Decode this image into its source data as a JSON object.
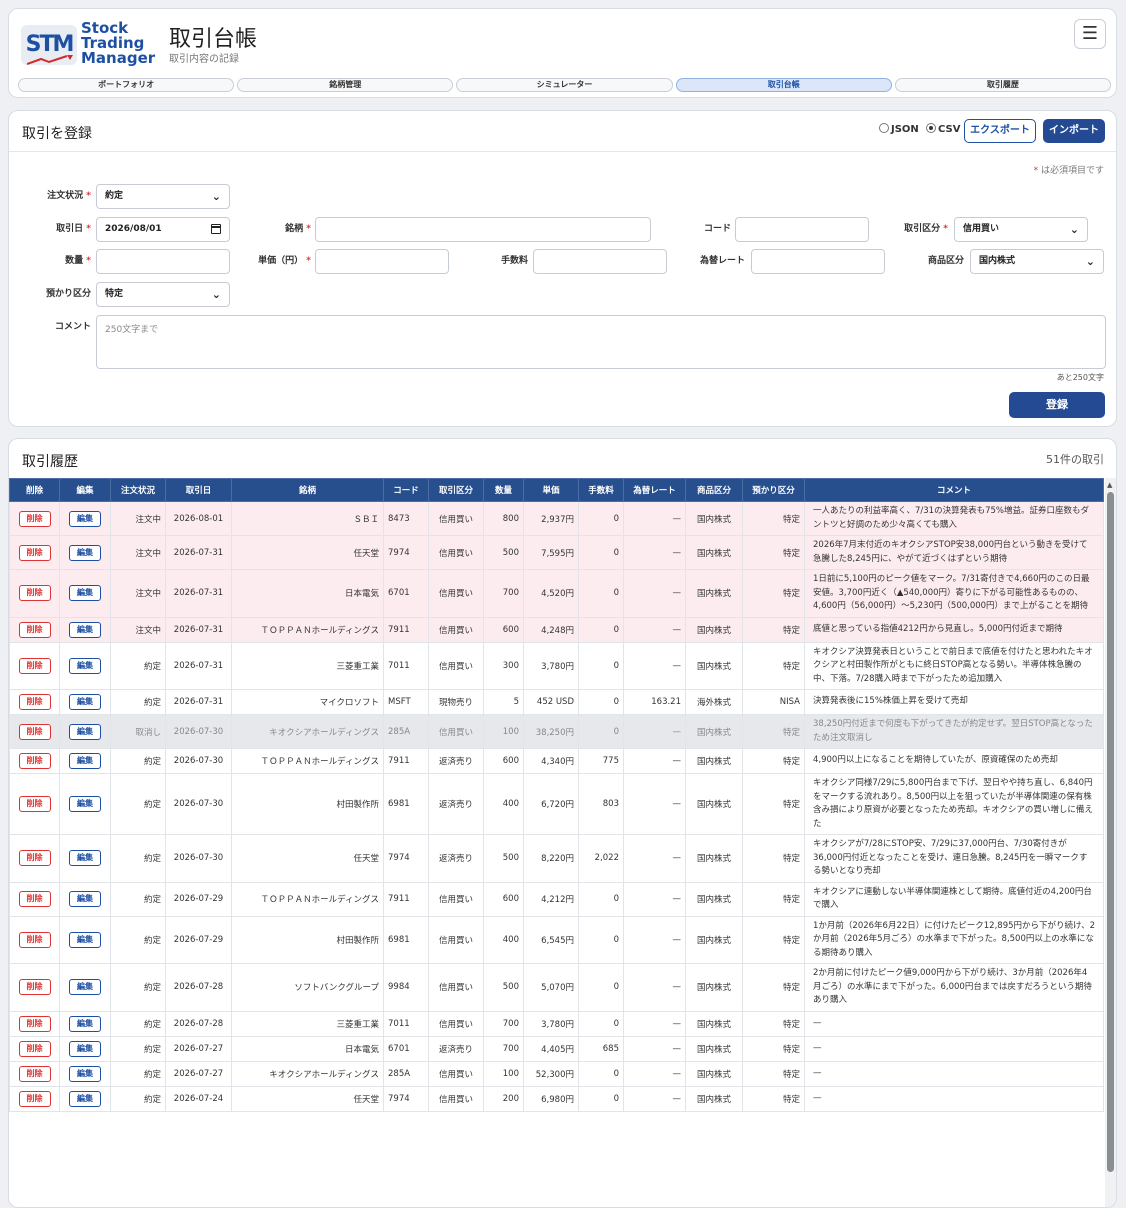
{
  "app": {
    "logo_short": "STM",
    "logo_line1": "Stock",
    "logo_line2": "Trading",
    "logo_line3": "Manager",
    "title": "取引台帳",
    "subtitle": "取引内容の記録"
  },
  "tabs": [
    {
      "label": "ポートフォリオ"
    },
    {
      "label": "銘柄管理"
    },
    {
      "label": "シミュレーター"
    },
    {
      "label": "取引台帳",
      "active": true
    },
    {
      "label": "取引履歴"
    }
  ],
  "form": {
    "title": "取引を登録",
    "json_label": "JSON",
    "csv_label": "CSV",
    "export_label": "エクスポート",
    "import_label": "インポート",
    "required_note_mark": "*",
    "required_note": " は必須項目です",
    "labels": {
      "order_status": "注文状況",
      "trade_date": "取引日",
      "name": "銘柄",
      "code": "コード",
      "trade_type": "取引区分",
      "quantity": "数量",
      "price": "単価（円）",
      "fee": "手数料",
      "fx_rate": "為替レート",
      "product": "商品区分",
      "deposit": "預かり区分",
      "comment": "コメント"
    },
    "values": {
      "order_status": "約定",
      "trade_date": "2026/08/01",
      "trade_type": "信用買い",
      "product": "国内株式",
      "deposit": "特定"
    },
    "comment_placeholder": "250文字まで",
    "counter": "あと250文字",
    "submit_label": "登録"
  },
  "history": {
    "title": "取引履歴",
    "count": "51件の取引",
    "delete_label": "削除",
    "edit_label": "編集",
    "columns": [
      "削除",
      "編集",
      "注文状況",
      "取引日",
      "銘柄",
      "コード",
      "取引区分",
      "数量",
      "単価",
      "手数料",
      "為替レート",
      "商品区分",
      "預かり区分",
      "コメント"
    ],
    "rows": [
      {
        "status": "注文中",
        "date": "2026-08-01",
        "name": "ＳＢＩ",
        "code": "8473",
        "type": "信用買い",
        "qty": "800",
        "price": "2,937円",
        "fee": "0",
        "fx": "—",
        "product": "国内株式",
        "deposit": "特定",
        "comment": "一人あたりの利益率高く、7/31の決算発表も75%増益。証券口座数もダントツと好調のため少々高くても購入",
        "state": "pending"
      },
      {
        "status": "注文中",
        "date": "2026-07-31",
        "name": "任天堂",
        "code": "7974",
        "type": "信用買い",
        "qty": "500",
        "price": "7,595円",
        "fee": "0",
        "fx": "—",
        "product": "国内株式",
        "deposit": "特定",
        "comment": "2026年7月末付近のキオクシアSTOP安38,000円台という動きを受けて急騰した8,245円に、やがて近づくはずという期待",
        "state": "pending"
      },
      {
        "status": "注文中",
        "date": "2026-07-31",
        "name": "日本電気",
        "code": "6701",
        "type": "信用買い",
        "qty": "700",
        "price": "4,520円",
        "fee": "0",
        "fx": "—",
        "product": "国内株式",
        "deposit": "特定",
        "comment": "1日前に5,100円のピーク値をマーク。7/31寄付きで4,660円のこの日最安値。3,700円近く（▲540,000円）寄りに下がる可能性あるものの、4,600円（56,000円）～5,230円（500,000円）まで上がることを期待",
        "state": "pending"
      },
      {
        "status": "注文中",
        "date": "2026-07-31",
        "name": "ＴＯＰＰＡＮホールディングス",
        "code": "7911",
        "type": "信用買い",
        "qty": "600",
        "price": "4,248円",
        "fee": "0",
        "fx": "—",
        "product": "国内株式",
        "deposit": "特定",
        "comment": "底値と思っている指値4212円から見直し。5,000円付近まで期待",
        "state": "pending"
      },
      {
        "status": "約定",
        "date": "2026-07-31",
        "name": "三菱重工業",
        "code": "7011",
        "type": "信用買い",
        "qty": "300",
        "price": "3,780円",
        "fee": "0",
        "fx": "—",
        "product": "国内株式",
        "deposit": "特定",
        "comment": "キオクシア決算発表日ということで前日まで底値を付けたと思われたキオクシアと村田製作所がともに終日STOP高となる勢い。半導体株急騰の中、下落。7/28購入時まで下がったため追加購入",
        "state": ""
      },
      {
        "status": "約定",
        "date": "2026-07-31",
        "name": "マイクロソフト",
        "code": "MSFT",
        "type": "現物売り",
        "qty": "5",
        "price": "452 USD",
        "fee": "0",
        "fx": "163.21",
        "product": "海外株式",
        "deposit": "NISA",
        "comment": "決算発表後に15%株価上昇を受けて売却",
        "state": ""
      },
      {
        "status": "取消し",
        "date": "2026-07-30",
        "name": "キオクシアホールディングス",
        "code": "285A",
        "type": "信用買い",
        "qty": "100",
        "price": "38,250円",
        "fee": "0",
        "fx": "—",
        "product": "国内株式",
        "deposit": "特定",
        "comment": "38,250円付近まで何度も下がってきたが約定せず。翌日STOP高となったため注文取消し",
        "state": "cancel"
      },
      {
        "status": "約定",
        "date": "2026-07-30",
        "name": "ＴＯＰＰＡＮホールディングス",
        "code": "7911",
        "type": "返済売り",
        "qty": "600",
        "price": "4,340円",
        "fee": "775",
        "fx": "—",
        "product": "国内株式",
        "deposit": "特定",
        "comment": "4,900円以上になることを期待していたが、原資確保のため売却",
        "state": ""
      },
      {
        "status": "約定",
        "date": "2026-07-30",
        "name": "村田製作所",
        "code": "6981",
        "type": "返済売り",
        "qty": "400",
        "price": "6,720円",
        "fee": "803",
        "fx": "—",
        "product": "国内株式",
        "deposit": "特定",
        "comment": "キオクシア同様7/29に5,800円台まで下げ、翌日やや持ち直し、6,840円をマークする流れあり。8,500円以上を狙っていたが半導体関連の保有株含み損により原資が必要となったため売却。キオクシアの買い増しに備えた",
        "state": ""
      },
      {
        "status": "約定",
        "date": "2026-07-30",
        "name": "任天堂",
        "code": "7974",
        "type": "返済売り",
        "qty": "500",
        "price": "8,220円",
        "fee": "2,022",
        "fx": "—",
        "product": "国内株式",
        "deposit": "特定",
        "comment": "キオクシアが7/28にSTOP安、7/29に37,000円台、7/30寄付きが36,000円付近となったことを受け、連日急騰。8,245円を一瞬マークする勢いとなり売却",
        "state": ""
      },
      {
        "status": "約定",
        "date": "2026-07-29",
        "name": "ＴＯＰＰＡＮホールディングス",
        "code": "7911",
        "type": "信用買い",
        "qty": "600",
        "price": "4,212円",
        "fee": "0",
        "fx": "—",
        "product": "国内株式",
        "deposit": "特定",
        "comment": "キオクシアに連動しない半導体関連株として期待。底値付近の4,200円台で購入",
        "state": ""
      },
      {
        "status": "約定",
        "date": "2026-07-29",
        "name": "村田製作所",
        "code": "6981",
        "type": "信用買い",
        "qty": "400",
        "price": "6,545円",
        "fee": "0",
        "fx": "—",
        "product": "国内株式",
        "deposit": "特定",
        "comment": "1か月前（2026年6月22日）に付けたピーク12,895円から下がり続け、2か月前（2026年5月ごろ）の水準まで下がった。8,500円以上の水準になる期待あり購入",
        "state": ""
      },
      {
        "status": "約定",
        "date": "2026-07-28",
        "name": "ソフトバンクグループ",
        "code": "9984",
        "type": "信用買い",
        "qty": "500",
        "price": "5,070円",
        "fee": "0",
        "fx": "—",
        "product": "国内株式",
        "deposit": "特定",
        "comment": "2か月前に付けたピーク値9,000円から下がり続け、3か月前（2026年4月ごろ）の水準にまで下がった。6,000円台までは戻すだろうという期待あり購入",
        "state": ""
      },
      {
        "status": "約定",
        "date": "2026-07-28",
        "name": "三菱重工業",
        "code": "7011",
        "type": "信用買い",
        "qty": "700",
        "price": "3,780円",
        "fee": "0",
        "fx": "—",
        "product": "国内株式",
        "deposit": "特定",
        "comment": "—",
        "state": ""
      },
      {
        "status": "約定",
        "date": "2026-07-27",
        "name": "日本電気",
        "code": "6701",
        "type": "返済売り",
        "qty": "700",
        "price": "4,405円",
        "fee": "685",
        "fx": "—",
        "product": "国内株式",
        "deposit": "特定",
        "comment": "—",
        "state": ""
      },
      {
        "status": "約定",
        "date": "2026-07-27",
        "name": "キオクシアホールディングス",
        "code": "285A",
        "type": "信用買い",
        "qty": "100",
        "price": "52,300円",
        "fee": "0",
        "fx": "—",
        "product": "国内株式",
        "deposit": "特定",
        "comment": "—",
        "state": ""
      },
      {
        "status": "約定",
        "date": "2026-07-24",
        "name": "任天堂",
        "code": "7974",
        "type": "信用買い",
        "qty": "200",
        "price": "6,980円",
        "fee": "0",
        "fx": "—",
        "product": "国内株式",
        "deposit": "特定",
        "comment": "—",
        "state": ""
      }
    ]
  },
  "colors": {
    "primary": "#234a93",
    "header_row": "#284f8d",
    "pending_row": "#fcecf0",
    "cancel_row": "#e7e8eb",
    "danger": "#dd3333"
  }
}
